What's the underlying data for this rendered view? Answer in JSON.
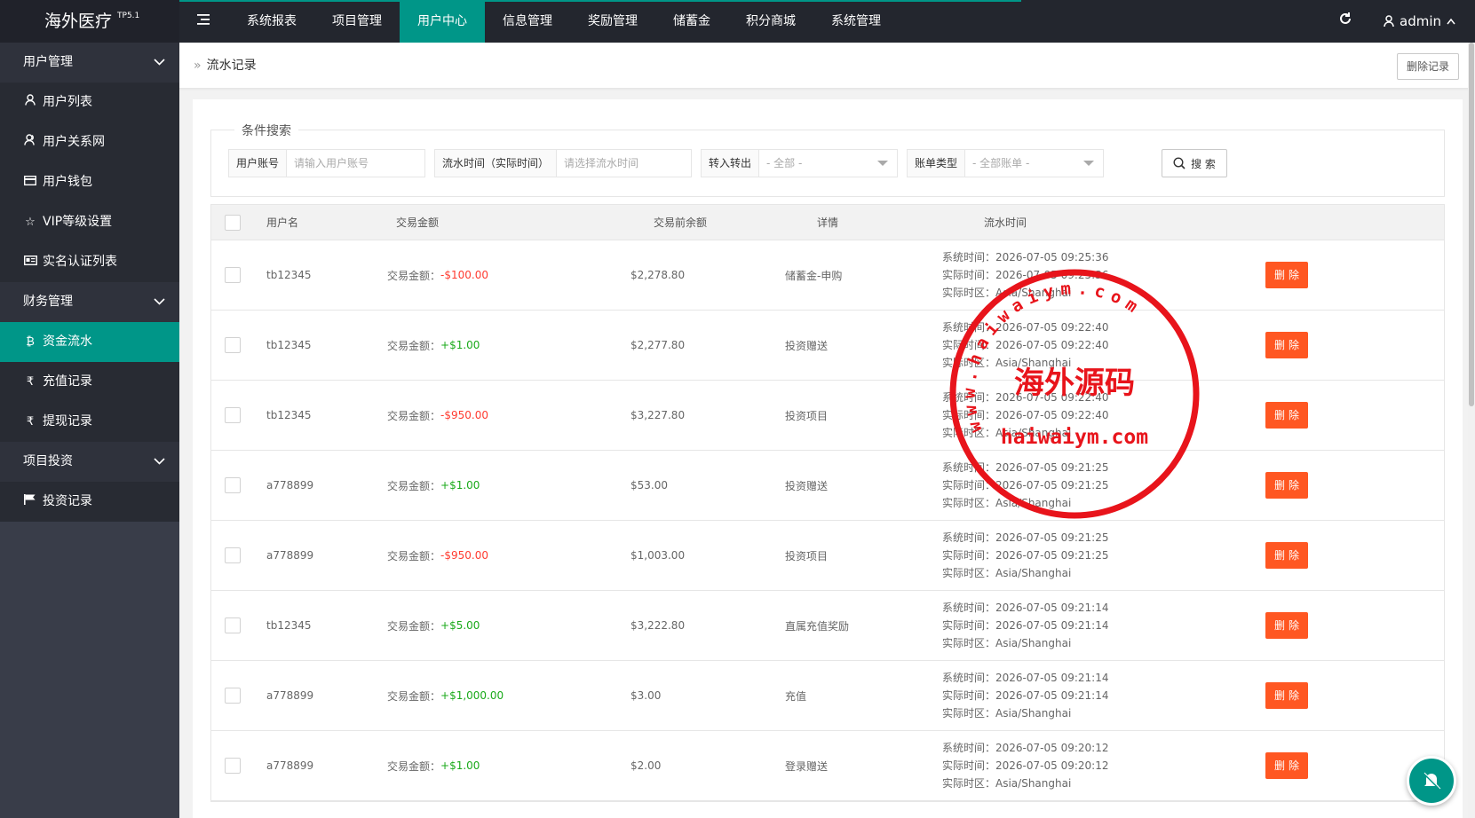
{
  "app": {
    "title": "海外医疗",
    "version": "TP5.1"
  },
  "topnav": {
    "menu_icon": "menu-icon",
    "items": [
      {
        "label": "系统报表"
      },
      {
        "label": "项目管理"
      },
      {
        "label": "用户中心",
        "active": true
      },
      {
        "label": "信息管理"
      },
      {
        "label": "奖励管理"
      },
      {
        "label": "储蓄金"
      },
      {
        "label": "积分商城"
      },
      {
        "label": "系统管理"
      }
    ],
    "refresh_icon": "refresh-icon",
    "user": "admin"
  },
  "sidebar": {
    "groups": [
      {
        "label": "用户管理",
        "items": [
          {
            "label": "用户列表",
            "icon": "user-icon"
          },
          {
            "label": "用户关系网",
            "icon": "users-icon"
          },
          {
            "label": "用户钱包",
            "icon": "wallet-icon"
          },
          {
            "label": "VIP等级设置",
            "icon": "star-icon"
          },
          {
            "label": "实名认证列表",
            "icon": "idcard-icon"
          }
        ]
      },
      {
        "label": "财务管理",
        "items": [
          {
            "label": "资金流水",
            "icon": "bitcoin-icon",
            "active": true
          },
          {
            "label": "充值记录",
            "icon": "rupee-icon"
          },
          {
            "label": "提现记录",
            "icon": "rupee-icon"
          }
        ]
      },
      {
        "label": "项目投资",
        "items": [
          {
            "label": "投资记录",
            "icon": "flag-icon"
          }
        ]
      }
    ]
  },
  "breadcrumb": {
    "label": "流水记录",
    "action": "删除记录"
  },
  "search": {
    "legend": "条件搜索",
    "account": {
      "label": "用户账号",
      "placeholder": "请输入用户账号"
    },
    "time": {
      "label": "流水时间（实际时间）",
      "placeholder": "请选择流水时间"
    },
    "direction": {
      "label": "转入转出",
      "value": "- 全部 -"
    },
    "type": {
      "label": "账单类型",
      "value": "- 全部账单 -"
    },
    "button": "搜 索"
  },
  "table": {
    "headers": [
      "用户名",
      "交易金额",
      "交易前余额",
      "详情",
      "流水时间"
    ],
    "amount_prefix": "交易金额：",
    "time_labels": {
      "system": "系统时间：",
      "actual": "实际时间：",
      "zone": "实际时区："
    },
    "delete_label": "删除",
    "rows": [
      {
        "user": "tb12345",
        "amount": "-$100.00",
        "sign": "neg",
        "balance": "$2,278.80",
        "detail": "储蓄金-申购",
        "sys_time": "2026-07-05 09:25:36",
        "act_time": "2026-07-05 09:25:36",
        "zone": "Asia/Shanghai"
      },
      {
        "user": "tb12345",
        "amount": "+$1.00",
        "sign": "pos",
        "balance": "$2,277.80",
        "detail": "投资赠送",
        "sys_time": "2026-07-05 09:22:40",
        "act_time": "2026-07-05 09:22:40",
        "zone": "Asia/Shanghai"
      },
      {
        "user": "tb12345",
        "amount": "-$950.00",
        "sign": "neg",
        "balance": "$3,227.80",
        "detail": "投资项目",
        "sys_time": "2026-07-05 09:22:40",
        "act_time": "2026-07-05 09:22:40",
        "zone": "Asia/Shanghai"
      },
      {
        "user": "a778899",
        "amount": "+$1.00",
        "sign": "pos",
        "balance": "$53.00",
        "detail": "投资赠送",
        "sys_time": "2026-07-05 09:21:25",
        "act_time": "2026-07-05 09:21:25",
        "zone": "Asia/Shanghai"
      },
      {
        "user": "a778899",
        "amount": "-$950.00",
        "sign": "neg",
        "balance": "$1,003.00",
        "detail": "投资项目",
        "sys_time": "2026-07-05 09:21:25",
        "act_time": "2026-07-05 09:21:25",
        "zone": "Asia/Shanghai"
      },
      {
        "user": "tb12345",
        "amount": "+$5.00",
        "sign": "pos",
        "balance": "$3,222.80",
        "detail": "直属充值奖励",
        "sys_time": "2026-07-05 09:21:14",
        "act_time": "2026-07-05 09:21:14",
        "zone": "Asia/Shanghai"
      },
      {
        "user": "a778899",
        "amount": "+$1,000.00",
        "sign": "pos",
        "balance": "$3.00",
        "detail": "充值",
        "sys_time": "2026-07-05 09:21:14",
        "act_time": "2026-07-05 09:21:14",
        "zone": "Asia/Shanghai"
      },
      {
        "user": "a778899",
        "amount": "+$1.00",
        "sign": "pos",
        "balance": "$2.00",
        "detail": "登录赠送",
        "sys_time": "2026-07-05 09:20:12",
        "act_time": "2026-07-05 09:20:12",
        "zone": "Asia/Shanghai"
      }
    ]
  },
  "watermark": {
    "center": "海外源码",
    "url": "haiwaiym.com",
    "arc": "www.haiwaiym.com"
  },
  "colors": {
    "accent": "#009688",
    "danger": "#ff5722",
    "negative": "#ff3b30",
    "positive": "#1aaa1a",
    "stamp": "#e8141b"
  }
}
